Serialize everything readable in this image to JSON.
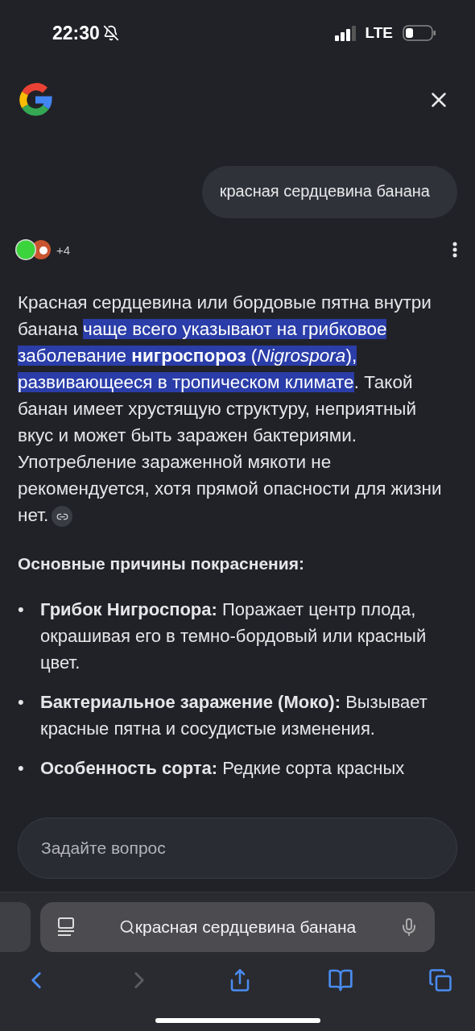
{
  "status_bar": {
    "time": "22:30",
    "network": "LTE"
  },
  "query": "красная сердцевина банана",
  "sources": {
    "count": "+4"
  },
  "answer": {
    "paragraph": [
      {
        "text": "Красная сердцевина или бордовые пятна внутри банана ",
        "highlighted": false
      },
      {
        "text": "чаще всего указывают на грибковое заболевание **нигроспороз** (*Nigrospora*), развивающееся в тропическом климате",
        "highlighted": true
      },
      {
        "text": ". Такой банан имеет хрустящую структуру, неприятный вкус и может быть заражен бактериями. Употребление зараженной мякоти не рекомендуется, хотя прямой опасности для жизни нет.",
        "highlighted": false
      }
    ],
    "heading": "Основные причины покраснения:",
    "bullets": [
      {
        "marker": "•",
        "text": "**Грибок Нигроспора:** Поражает центр плода, окрашивая его в темно-бордовый или красный цвет."
      },
      {
        "marker": "•",
        "text": "**Бактериальное заражение (Моко):** Вызывает красные пятна и сосудистые изменения."
      },
      {
        "marker": "•",
        "text": "**Особенность сорта:** Редкие сорта красных"
      }
    ]
  },
  "ask_field": {
    "placeholder": "Задайте вопрос"
  },
  "browser": {
    "address": "красная сердцевина банана",
    "back_disabled": false,
    "forward_disabled": true
  }
}
